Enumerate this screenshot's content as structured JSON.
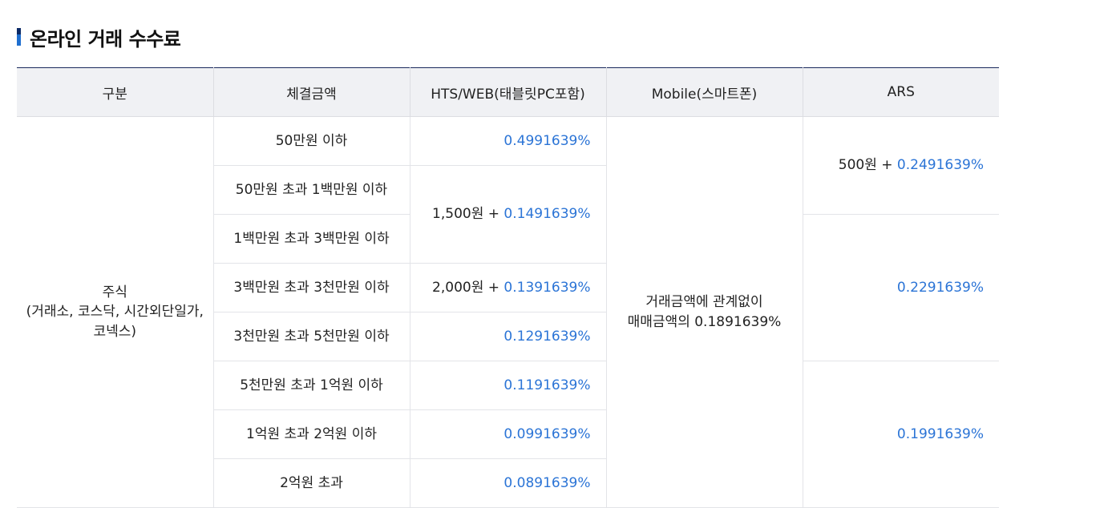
{
  "page": {
    "title": "온라인 거래 수수료"
  },
  "table": {
    "headers": [
      "구분",
      "체결금액",
      "HTS/WEB(태블릿PC포함)",
      "Mobile(스마트폰)",
      "ARS"
    ],
    "category": {
      "line1": "주식",
      "line2": "(거래소, 코스닥, 시간외단일가,",
      "line3": "코넥스)"
    },
    "amounts": [
      "50만원 이하",
      "50만원 초과 1백만원 이하",
      "1백만원 초과 3백만원 이하",
      "3백만원 초과 3천만원 이하",
      "3천만원 초과 5천만원 이하",
      "5천만원 초과 1억원 이하",
      "1억원 초과 2억원 이하",
      "2억원 초과"
    ],
    "hts": {
      "r1": {
        "pct": "0.4991639%"
      },
      "r23": {
        "base": "1,500원 + ",
        "pct": "0.1491639%"
      },
      "r4": {
        "base": "2,000원 + ",
        "pct": "0.1391639%"
      },
      "r5": {
        "pct": "0.1291639%"
      },
      "r6": {
        "pct": "0.1191639%"
      },
      "r7": {
        "pct": "0.0991639%"
      },
      "r8": {
        "pct": "0.0891639%"
      }
    },
    "mobile": {
      "line1": "거래금액에 관계없이",
      "line2": "매매금액의 0.1891639%"
    },
    "ars": {
      "g1": {
        "base": "500원 + ",
        "pct": "0.2491639%"
      },
      "g2": {
        "pct": "0.2291639%"
      },
      "g3": {
        "pct": "0.1991639%"
      }
    }
  },
  "colors": {
    "accent": "#2b74d6",
    "title_bar": "#1f6fcf",
    "header_bg": "#f0f1f4",
    "table_top_border": "#1b2a5c"
  }
}
